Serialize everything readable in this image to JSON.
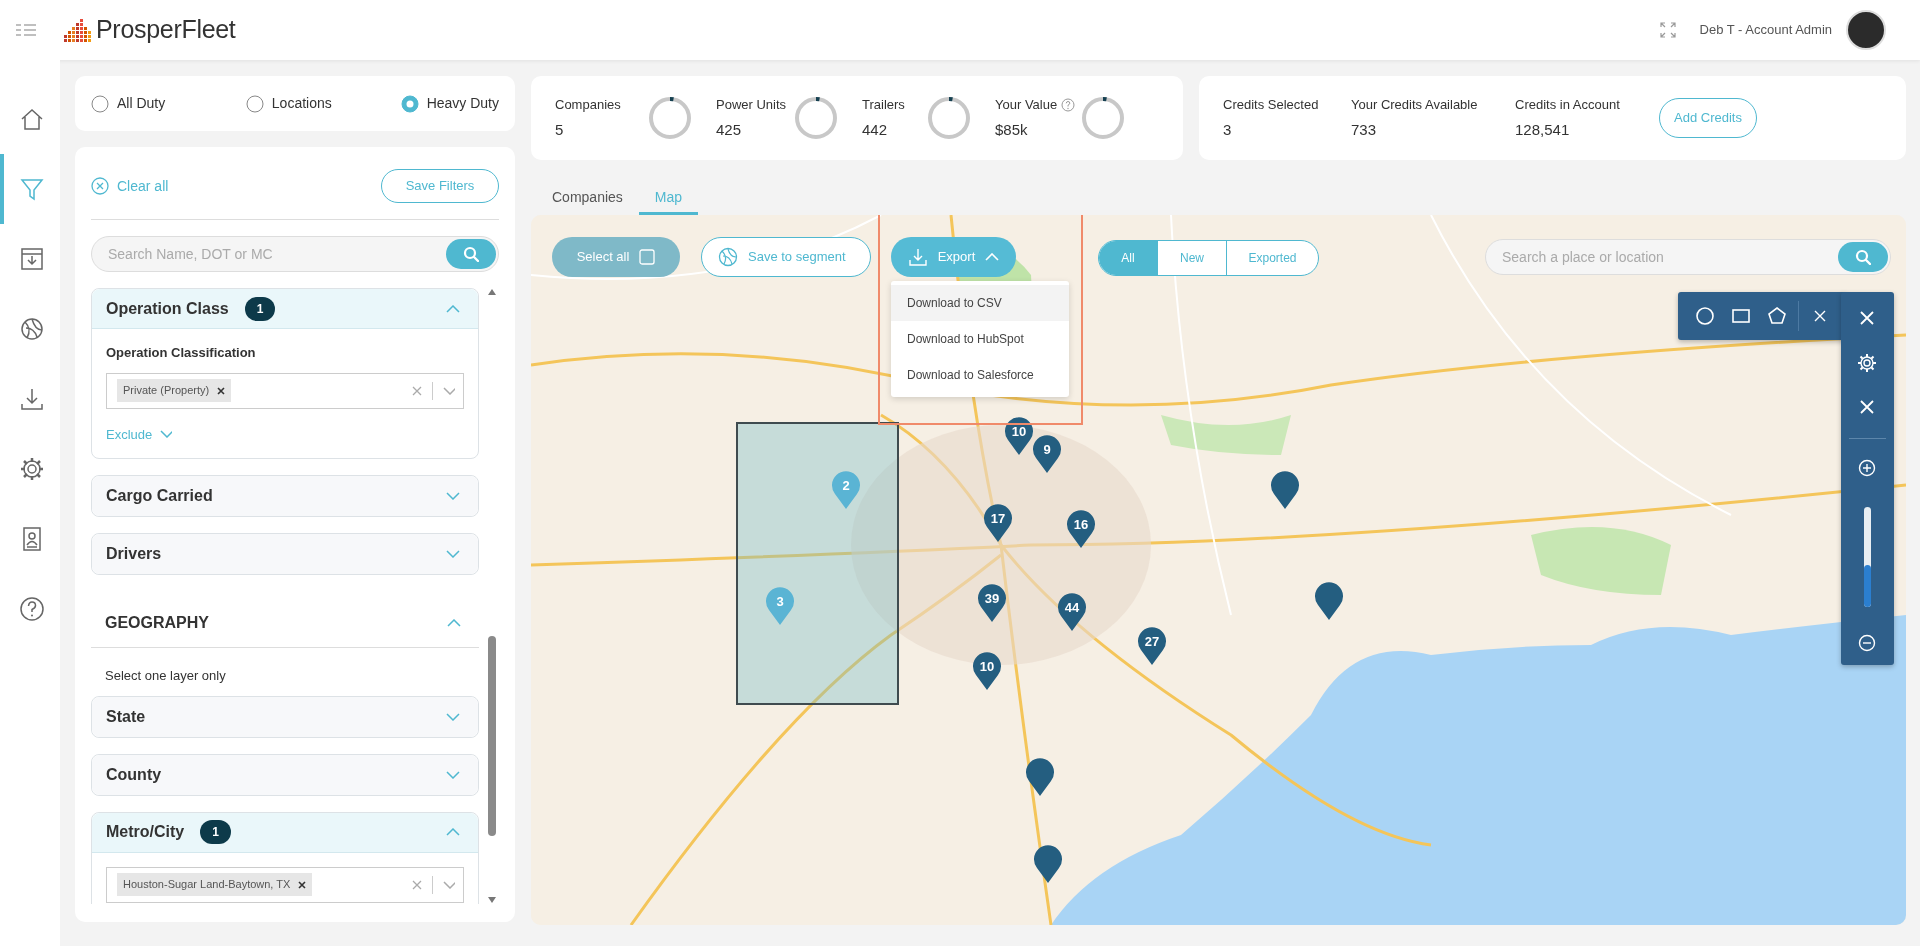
{
  "header": {
    "brand": "ProsperFleet",
    "user": "Deb T - Account Admin"
  },
  "rail": [
    {
      "selected": false
    },
    {
      "selected": true
    },
    {
      "selected": false
    },
    {
      "selected": false
    },
    {
      "selected": false
    },
    {
      "selected": false
    },
    {
      "selected": false
    },
    {
      "selected": false
    }
  ],
  "duty_options": [
    {
      "label": "All Duty",
      "selected": false
    },
    {
      "label": "Locations",
      "selected": false
    },
    {
      "label": "Heavy Duty",
      "selected": true
    }
  ],
  "filters": {
    "clear_all": "Clear all",
    "save": "Save Filters",
    "search": {
      "placeholder": "Search Name, DOT or MC"
    },
    "sections": [
      {
        "kind": "panel",
        "title": "Operation Class",
        "count": "1",
        "expanded": true,
        "field_label": "Operation Classification",
        "tags": [
          "Private (Property)"
        ],
        "exclude": "Exclude"
      },
      {
        "kind": "panel",
        "title": "Cargo Carried",
        "expanded": false
      },
      {
        "kind": "panel",
        "title": "Drivers",
        "expanded": false
      },
      {
        "kind": "heading",
        "title": "GEOGRAPHY",
        "expanded": true
      },
      {
        "kind": "note",
        "title": "Select one layer only"
      },
      {
        "kind": "panel",
        "title": "State",
        "expanded": false
      },
      {
        "kind": "panel",
        "title": "County",
        "expanded": false
      },
      {
        "kind": "panel",
        "title": "Metro/City",
        "count": "1",
        "expanded": true,
        "tags": [
          "Houston-Sugar Land-Baytown, TX"
        ]
      }
    ]
  },
  "stats": [
    {
      "label": "Companies",
      "value": "5",
      "info": false,
      "level": 0.03
    },
    {
      "label": "Power Units",
      "value": "425",
      "info": false,
      "level": 0.03
    },
    {
      "label": "Trailers",
      "value": "442",
      "info": false,
      "level": 0.03
    },
    {
      "label": "Your Value",
      "value": "$85k",
      "info": true,
      "level": 0.03
    }
  ],
  "credits": [
    {
      "label": "Credits Selected",
      "value": "3"
    },
    {
      "label": "Your Credits Available",
      "value": "733"
    },
    {
      "label": "Credits in Account",
      "value": "128,541"
    }
  ],
  "add_credits": "Add Credits",
  "tabs": [
    {
      "label": "Companies",
      "selected": false
    },
    {
      "label": "Map",
      "selected": true
    }
  ],
  "map": {
    "select_all": {
      "label": "Select all",
      "checked": false
    },
    "save_segment": "Save to segment",
    "export": {
      "label": "Export",
      "expanded": true,
      "annotated": true,
      "items": [
        {
          "label": "Download to CSV",
          "highlighted": true
        },
        {
          "label": "Download to HubSpot",
          "highlighted": false
        },
        {
          "label": "Download to Salesforce",
          "highlighted": false
        }
      ]
    },
    "filter_tabs": [
      {
        "label": "All",
        "selected": true
      },
      {
        "label": "New",
        "selected": false
      },
      {
        "label": "Exported",
        "selected": false
      }
    ],
    "search": {
      "placeholder": "Search a place or location"
    },
    "selection_area": true,
    "markers": [
      {
        "label": "10",
        "selected": false
      },
      {
        "label": "9",
        "selected": false
      },
      {
        "label": "2",
        "selected": true
      },
      {
        "selected": false
      },
      {
        "label": "17",
        "selected": false
      },
      {
        "label": "16",
        "selected": false
      },
      {
        "label": "3",
        "selected": true
      },
      {
        "label": "39",
        "selected": false
      },
      {
        "label": "44",
        "selected": false
      },
      {
        "selected": false
      },
      {
        "label": "27",
        "selected": false
      },
      {
        "label": "10",
        "selected": false
      },
      {
        "selected": false
      },
      {
        "selected": false
      }
    ],
    "zoom": {
      "level": 0.42
    }
  }
}
